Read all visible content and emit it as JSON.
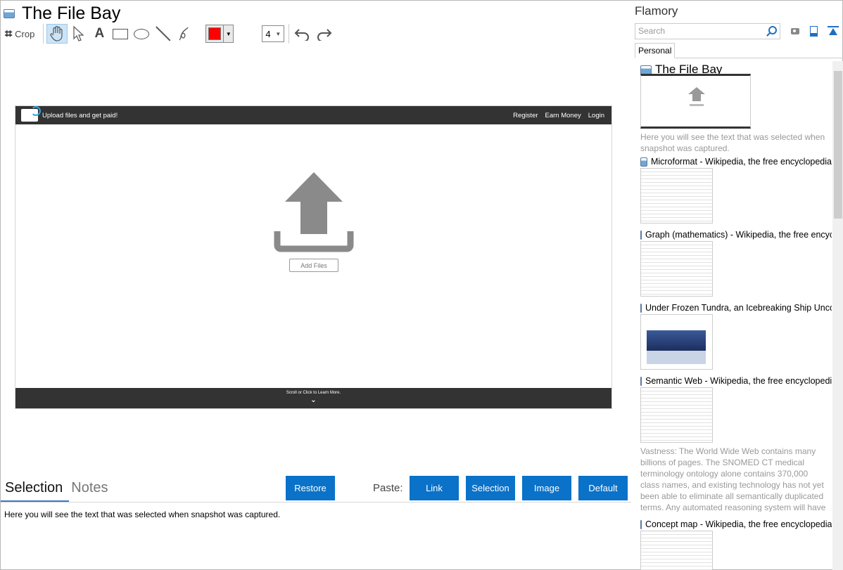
{
  "title": "The File Bay",
  "toolbar": {
    "crop_label": "Crop",
    "stroke_color": "#ff0000",
    "stroke_width": "4"
  },
  "snapshot": {
    "tagline": "Upload files and get paid!",
    "nav": [
      "Register",
      "Earn Money",
      "Login"
    ],
    "add_files": "Add Files",
    "footer_text": "Scroll or Click to Learn More."
  },
  "bottom": {
    "tabs": [
      "Selection",
      "Notes"
    ],
    "restore": "Restore",
    "paste_label": "Paste:",
    "paste_buttons": [
      "Link",
      "Selection",
      "Image",
      "Default"
    ],
    "selection_text": "Here you will see the text that was selected when snapshot was captured.",
    "accent_color": "#0a72c9"
  },
  "sidebar": {
    "app_name": "Flamory",
    "search_placeholder": "Search",
    "tab": "Personal",
    "items": [
      {
        "title": "The File Bay",
        "desc": "Here you will see the text that was selected when snapshot was captured."
      },
      {
        "title": "Microformat - Wikipedia, the free encyclopedia",
        "desc": ""
      },
      {
        "title": "Graph (mathematics) - Wikipedia, the free encyclopedia",
        "desc": ""
      },
      {
        "title": "Under Frozen Tundra, an Icebreaking Ship Uncovers an Oil Reserve",
        "desc": ""
      },
      {
        "title": "Semantic Web - Wikipedia, the free encyclopedia",
        "desc": "Vastness: The World Wide Web contains many billions of pages. The SNOMED CT medical terminology ontology alone contains 370,000 class names, and existing technology has not yet been able to eliminate all semantically duplicated terms. Any automated reasoning system will have to deal with truly huge inputs."
      },
      {
        "title": "Concept map - Wikipedia, the free encyclopedia",
        "desc": ""
      }
    ]
  }
}
